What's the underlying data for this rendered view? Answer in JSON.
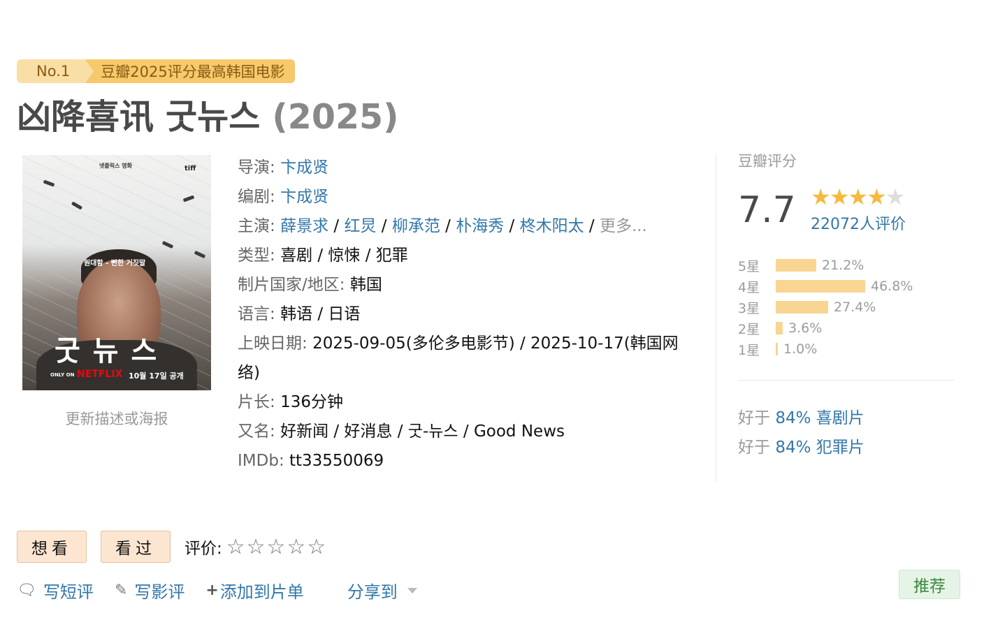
{
  "badge": {
    "rank": "No.1",
    "text": "豆瓣2025评分最高韩国电影"
  },
  "title": {
    "name": "凶降喜讯 굿뉴스",
    "year": "(2025)"
  },
  "poster": {
    "top_text": "넷플릭스 영화",
    "logo": "tiff",
    "tagline": "원대함 - 뻔한 거짓말",
    "big_title": "굿 뉴 스",
    "only_on": "ONLY ON",
    "netflix": "NETFLIX",
    "release": "10월 17일 공개"
  },
  "update_link": "更新描述或海报",
  "info": {
    "director": {
      "label": "导演",
      "value": "卞成贤"
    },
    "writer": {
      "label": "编剧",
      "value": "卞成贤"
    },
    "cast": {
      "label": "主演",
      "names": [
        "薛景求",
        "红炅",
        "柳承范",
        "朴海秀",
        "柊木阳太"
      ],
      "more": "更多..."
    },
    "genre": {
      "label": "类型",
      "value": "喜剧 / 惊悚 / 犯罪"
    },
    "country": {
      "label": "制片国家/地区",
      "value": "韩国"
    },
    "language": {
      "label": "语言",
      "value": "韩语 / 日语"
    },
    "release": {
      "label": "上映日期",
      "value": "2025-09-05(多伦多电影节) / 2025-10-17(韩国网络)"
    },
    "runtime": {
      "label": "片长",
      "value": "136分钟"
    },
    "aka": {
      "label": "又名",
      "value": "好新闻 / 好消息 / 굿-뉴스 / Good News"
    },
    "imdb": {
      "label": "IMDb",
      "value": "tt33550069"
    }
  },
  "rating": {
    "label": "豆瓣评分",
    "score": "7.7",
    "stars": 4,
    "people": "22072人评价",
    "distribution": [
      {
        "label": "5星",
        "percent": "21.2%",
        "value": 21.2
      },
      {
        "label": "4星",
        "percent": "46.8%",
        "value": 46.8
      },
      {
        "label": "3星",
        "percent": "27.4%",
        "value": 27.4
      },
      {
        "label": "2星",
        "percent": "3.6%",
        "value": 3.6
      },
      {
        "label": "1星",
        "percent": "1.0%",
        "value": 1.0
      }
    ],
    "better_than": [
      {
        "prefix": "好于",
        "link": "84% 喜剧片"
      },
      {
        "prefix": "好于",
        "link": "84% 犯罪片"
      }
    ]
  },
  "actions": {
    "want": "想看",
    "watched": "看过",
    "rate_label": "评价:",
    "write_short": "写短评",
    "write_review": "写影评",
    "add_list": "添加到片单",
    "share": "分享到",
    "recommend": "推荐"
  },
  "colors": {
    "link": "#3377aa",
    "star": "#f7b93c",
    "bar": "#f8d592",
    "badge": "#f6c96a"
  }
}
